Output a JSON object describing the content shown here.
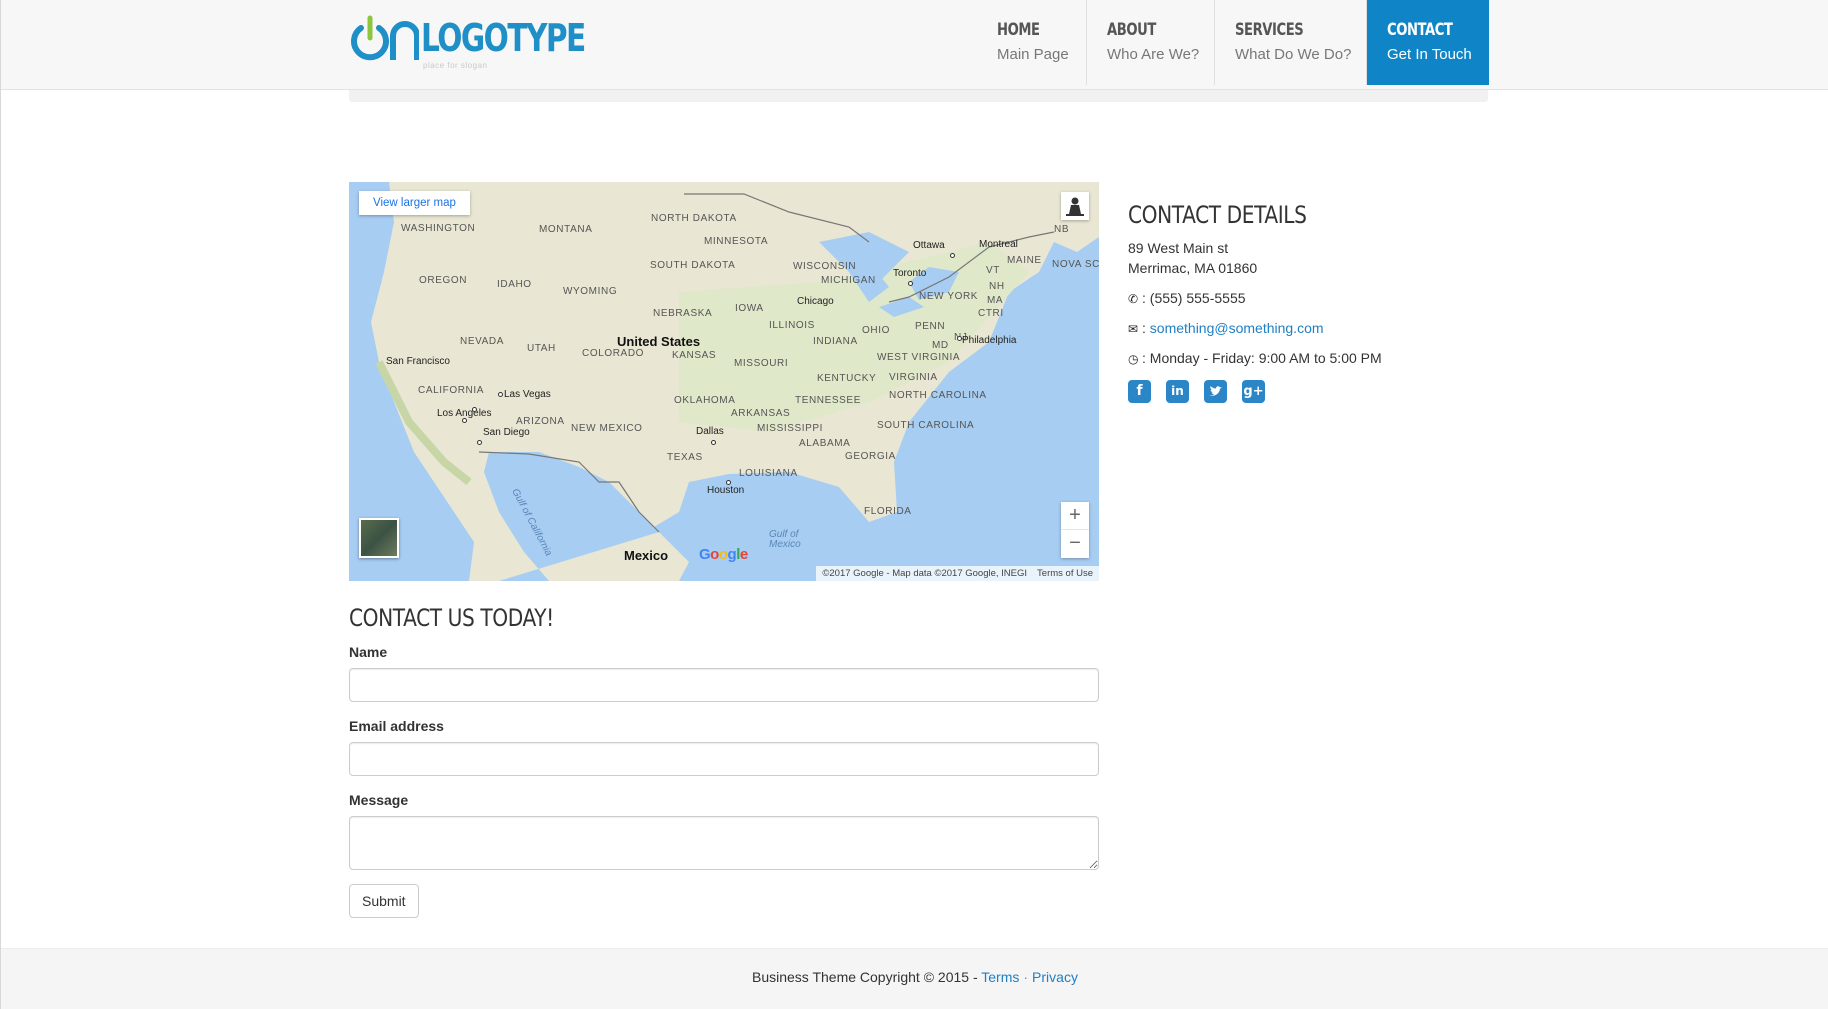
{
  "header": {
    "logo_text": "LOGOTYPE",
    "logo_tagline": "place for slogan",
    "nav": [
      {
        "title": "HOME",
        "subtitle": "Main Page"
      },
      {
        "title": "ABOUT",
        "subtitle": "Who Are We?"
      },
      {
        "title": "SERVICES",
        "subtitle": "What Do We Do?"
      },
      {
        "title": "CONTACT",
        "subtitle": "Get In Touch"
      }
    ],
    "active_nav": "CONTACT",
    "accent_color": "#0f85c8"
  },
  "map": {
    "view_larger": "View larger map",
    "zoom_in": "+",
    "zoom_out": "−",
    "google": "Google",
    "attribution": "©2017 Google - Map data ©2017 Google, INEGI",
    "terms": "Terms of Use",
    "states": [
      "WASHINGTON",
      "MONTANA",
      "NORTH DAKOTA",
      "MINNESOTA",
      "OREGON",
      "IDAHO",
      "WYOMING",
      "SOUTH DAKOTA",
      "WISCONSIN",
      "MICHIGAN",
      "NEBRASKA",
      "IOWA",
      "NEVADA",
      "UTAH",
      "COLORADO",
      "KANSAS",
      "ILLINOIS",
      "INDIANA",
      "OHIO",
      "PENN",
      "CALIFORNIA",
      "MISSOURI",
      "KENTUCKY",
      "WEST VIRGINIA",
      "VIRGINIA",
      "ARIZONA",
      "NEW MEXICO",
      "OKLAHOMA",
      "ARKANSAS",
      "TENNESSEE",
      "NORTH CAROLINA",
      "MISSISSIPPI",
      "ALABAMA",
      "SOUTH CAROLINA",
      "GEORGIA",
      "TEXAS",
      "LOUISIANA",
      "FLORIDA",
      "MAINE",
      "VT",
      "NH",
      "NEW YORK",
      "MA",
      "CTRI",
      "MD",
      "NJ",
      "NB",
      "NOVA SC"
    ],
    "cities": [
      "San Francisco",
      "Las Vegas",
      "Los Angeles",
      "San Diego",
      "Dallas",
      "Houston",
      "Chicago",
      "Toronto",
      "Ottawa",
      "Montreal",
      "Philadelphia"
    ],
    "countries": [
      "United States",
      "Mexico"
    ],
    "water": [
      "Gulf of California",
      "Gulf of Mexico"
    ]
  },
  "form": {
    "title": "CONTACT US TODAY!",
    "name_label": "Name",
    "email_label": "Email address",
    "message_label": "Message",
    "submit_label": "Submit"
  },
  "contact": {
    "title": "CONTACT DETAILS",
    "address_line1": "89 West Main st",
    "address_line2": "Merrimac, MA 01860",
    "phone": ": (555) 555-5555",
    "email_prefix": ":",
    "email": "something@something.com",
    "hours": ": Monday - Friday: 9:00 AM to 5:00 PM",
    "socials": [
      "facebook-icon",
      "linkedin-icon",
      "twitter-icon",
      "google-plus-icon"
    ]
  },
  "footer": {
    "copyright": "Business Theme Copyright © 2015 - ",
    "terms": "Terms",
    "privacy": "Privacy",
    "separator": "·"
  }
}
